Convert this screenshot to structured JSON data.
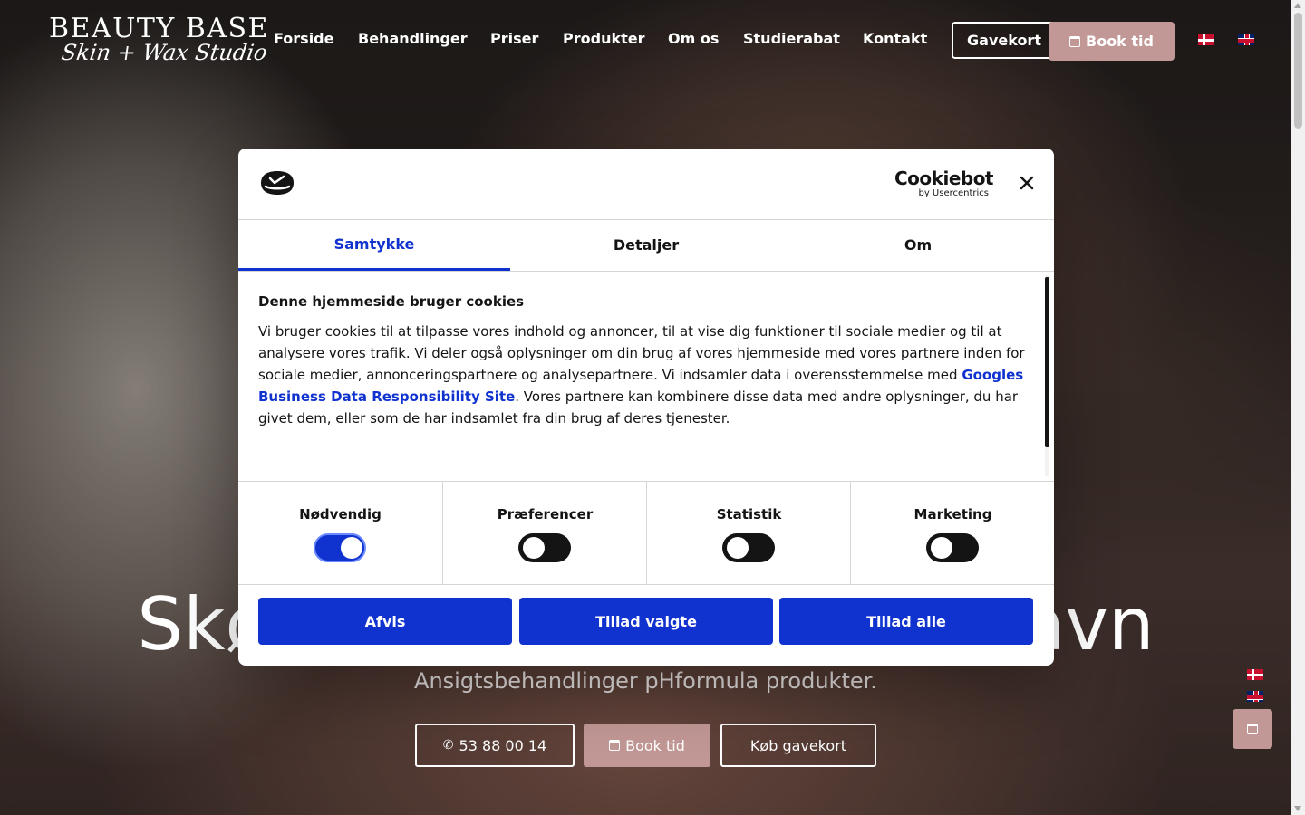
{
  "header": {
    "logo_top": "BEAUTY BASE",
    "logo_script": "Skin + Wax Studio",
    "nav": [
      "Forside",
      "Behandlinger",
      "Priser",
      "Produkter",
      "Om os",
      "Studierabat",
      "Kontakt"
    ],
    "gavekort_label": "Gavekort",
    "book_label": "Book tid",
    "languages": [
      "dk-flag-icon",
      "uk-flag-icon"
    ]
  },
  "hero": {
    "title": "Skønhedsklinik i København",
    "subtitle": "Ansigtsbehandlinger pHformula produkter.",
    "phone_label": "53 88 00 14",
    "book_label": "Book tid",
    "gift_label": "Køb gavekort"
  },
  "cookie_dialog": {
    "brand_main": "Cookiebot",
    "brand_sub": "by Usercentrics",
    "tabs": [
      {
        "label": "Samtykke",
        "active": true
      },
      {
        "label": "Detaljer",
        "active": false
      },
      {
        "label": "Om",
        "active": false
      }
    ],
    "title": "Denne hjemmeside bruger cookies",
    "text_before_link": "Vi bruger cookies til at tilpasse vores indhold og annoncer, til at vise dig funktioner til sociale medier og til at analysere vores trafik. Vi deler også oplysninger om din brug af vores hjemmeside med vores partnere inden for sociale medier, annonceringspartnere og analysepartnere. Vi indsamler data i overensstemmelse med ",
    "link_text": "Googles Business Data Responsibility Site",
    "text_after_link": ". Vores partnere kan kombinere disse data med andre oplysninger, du har givet dem, eller som de har indsamlet fra din brug af deres tjenester.",
    "toggles": [
      {
        "label": "Nødvendig",
        "on": true
      },
      {
        "label": "Præferencer",
        "on": false
      },
      {
        "label": "Statistik",
        "on": false
      },
      {
        "label": "Marketing",
        "on": false
      }
    ],
    "buttons": {
      "deny": "Afvis",
      "allow_selected": "Tillad valgte",
      "allow_all": "Tillad alle"
    },
    "colors": {
      "accent": "#1032cf",
      "text": "#141414"
    }
  },
  "colors": {
    "brand_pink": "#c29896"
  }
}
